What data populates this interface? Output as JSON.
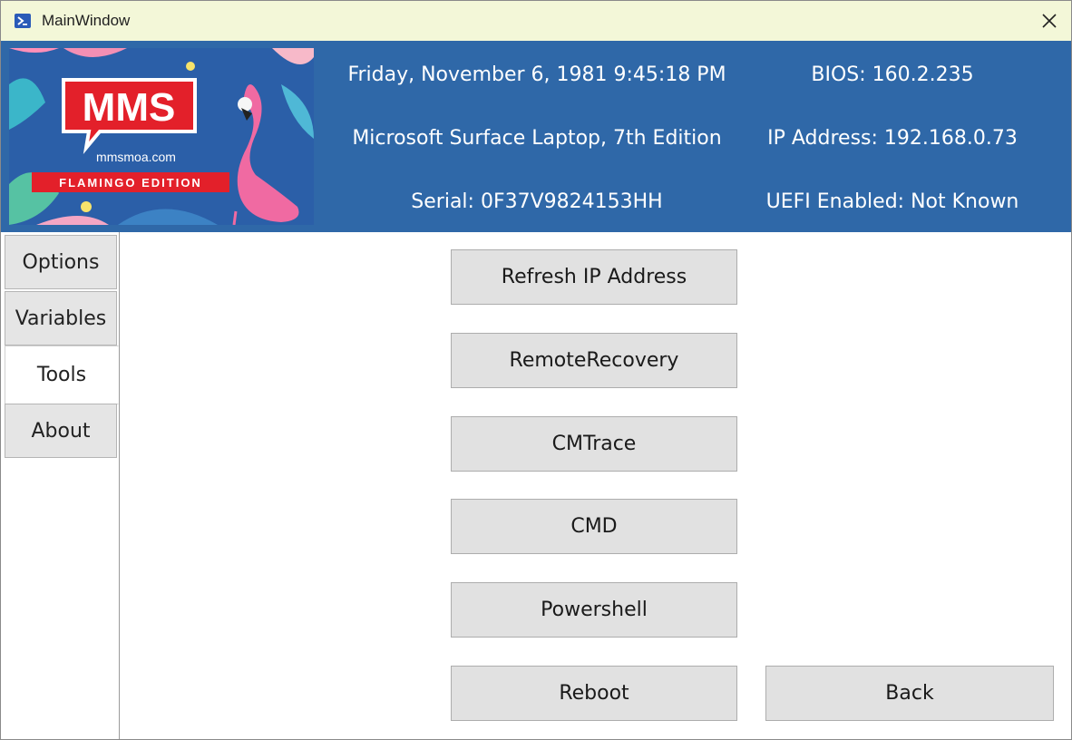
{
  "window": {
    "title": "MainWindow",
    "icon": "powershell-icon",
    "close_icon": "close-icon"
  },
  "banner": {
    "logo": "MMS",
    "site": "mmsmoa.com",
    "edition": "FLAMINGO EDITION"
  },
  "header": {
    "datetime": "Friday, November 6, 1981 9:45:18 PM",
    "bios": "BIOS: 160.2.235",
    "model": "Microsoft Surface Laptop, 7th Edition",
    "ip": "IP Address: 192.168.0.73",
    "serial": "Serial: 0F37V9824153HH",
    "uefi": "UEFI Enabled: Not Known"
  },
  "tabs": [
    {
      "label": "Options"
    },
    {
      "label": "Variables"
    },
    {
      "label": "Tools",
      "selected": true
    },
    {
      "label": "About"
    }
  ],
  "tools": {
    "refresh_ip": "Refresh IP Address",
    "remote_recovery": "RemoteRecovery",
    "cmtrace": "CMTrace",
    "cmd": "CMD",
    "powershell": "Powershell",
    "reboot": "Reboot",
    "back": "Back"
  },
  "colors": {
    "titlebar": "#f3f7d8",
    "header": "#2f68a8",
    "button": "#e1e1e1"
  }
}
